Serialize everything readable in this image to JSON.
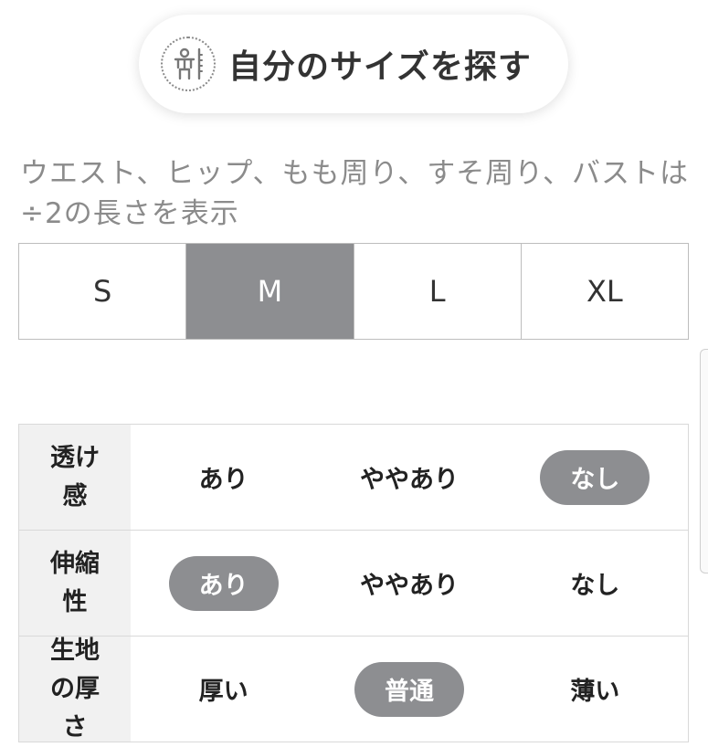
{
  "find_size": {
    "icon": "body-measure-icon",
    "label": "自分のサイズを探す"
  },
  "note": "ウエスト、ヒップ、もも周り、すそ周り、バストは÷2の長さを表示",
  "sizes": {
    "tabs": [
      "S",
      "M",
      "L",
      "XL"
    ],
    "selected": "M"
  },
  "colors": {
    "selected_bg": "#8d8e91",
    "label_bg": "#f1f1f1",
    "note_text": "#8b8b8b"
  },
  "attributes": [
    {
      "label": "透け感",
      "options": [
        "あり",
        "ややあり",
        "なし"
      ],
      "selected": 2
    },
    {
      "label": "伸縮性",
      "options": [
        "あり",
        "ややあり",
        "なし"
      ],
      "selected": 0
    },
    {
      "label": "生地の厚さ",
      "options": [
        "厚い",
        "普通",
        "薄い"
      ],
      "selected": 1
    }
  ]
}
